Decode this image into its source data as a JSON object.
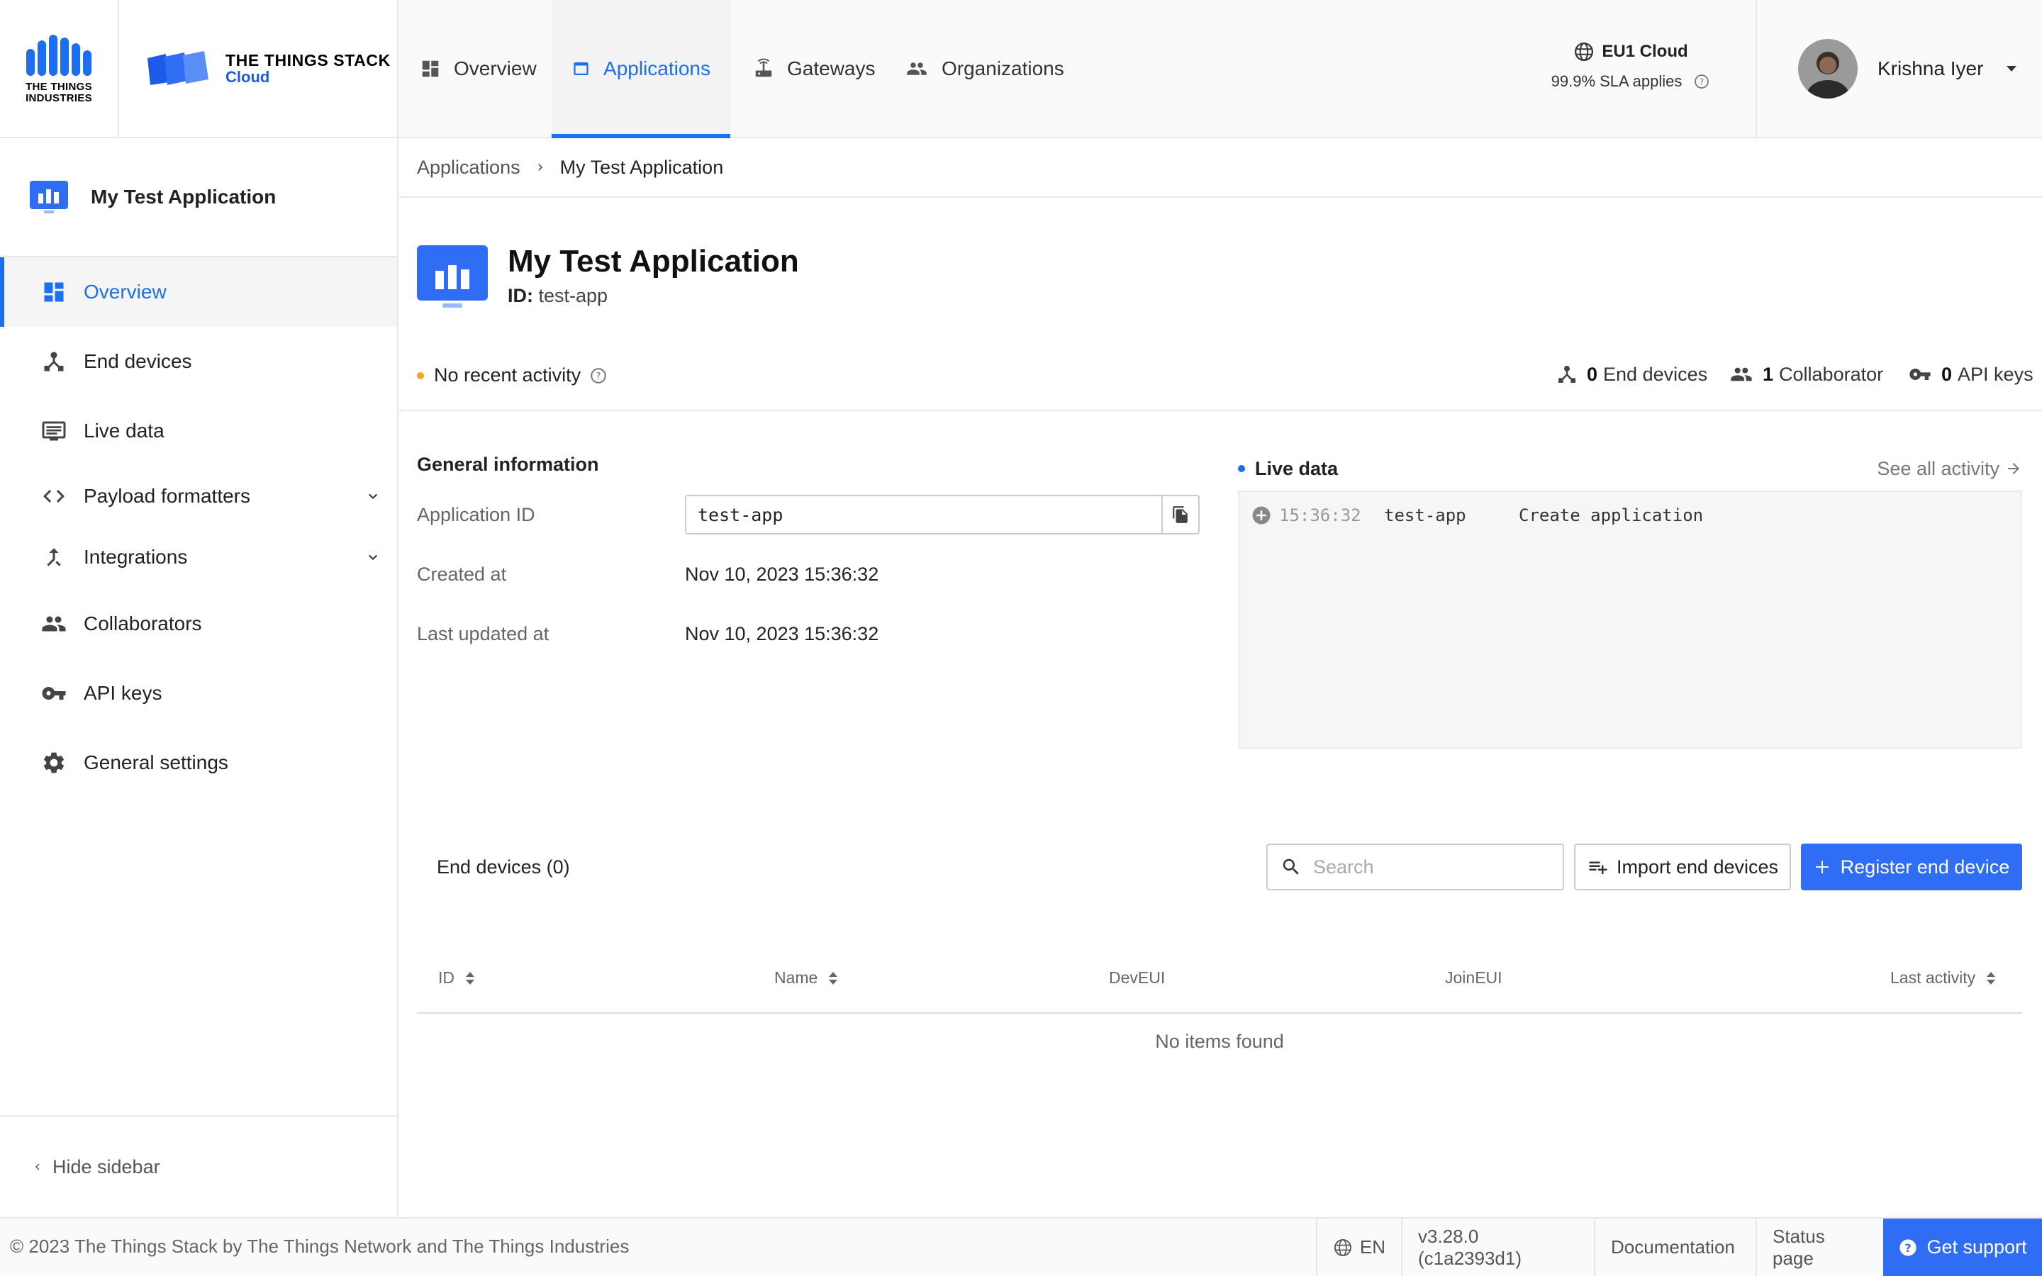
{
  "header": {
    "tti_logo_text": "THE THINGS INDUSTRIES",
    "tts_title": "THE THINGS STACK",
    "tts_subtitle": "Cloud",
    "nav": [
      {
        "label": "Overview",
        "icon": "dashboard-icon"
      },
      {
        "label": "Applications",
        "icon": "application-icon",
        "active": true
      },
      {
        "label": "Gateways",
        "icon": "gateway-icon"
      },
      {
        "label": "Organizations",
        "icon": "people-icon"
      }
    ],
    "cloud_name": "EU1 Cloud",
    "sla_text": "99.9% SLA applies",
    "user_name": "Krishna Iyer"
  },
  "sidebar": {
    "app_name": "My Test Application",
    "items": [
      {
        "label": "Overview",
        "icon": "dashboard-icon",
        "active": true
      },
      {
        "label": "End devices",
        "icon": "device-hub-icon"
      },
      {
        "label": "Live data",
        "icon": "live-data-icon"
      },
      {
        "label": "Payload formatters",
        "icon": "code-icon",
        "expandable": true
      },
      {
        "label": "Integrations",
        "icon": "integration-icon",
        "expandable": true
      },
      {
        "label": "Collaborators",
        "icon": "people-icon"
      },
      {
        "label": "API keys",
        "icon": "key-icon"
      },
      {
        "label": "General settings",
        "icon": "gear-icon"
      }
    ],
    "hide_label": "Hide sidebar"
  },
  "breadcrumb": {
    "items": [
      "Applications",
      "My Test Application"
    ]
  },
  "app": {
    "title": "My Test Application",
    "id_label": "ID:",
    "id_value": "test-app",
    "activity_status": "No recent activity",
    "stats": [
      {
        "count": "0",
        "label": "End devices",
        "icon": "device-hub-icon"
      },
      {
        "count": "1",
        "label": "Collaborator",
        "icon": "people-icon"
      },
      {
        "count": "0",
        "label": "API keys",
        "icon": "key-icon"
      }
    ]
  },
  "general_info": {
    "title": "General information",
    "rows": [
      {
        "label": "Application ID",
        "value": "test-app"
      },
      {
        "label": "Created at",
        "value": "Nov 10, 2023 15:36:32"
      },
      {
        "label": "Last updated at",
        "value": "Nov 10, 2023 15:36:32"
      }
    ]
  },
  "live_data": {
    "title": "Live data",
    "see_all": "See all activity",
    "events": [
      {
        "time": "15:36:32",
        "entity": "test-app",
        "description": "Create application"
      }
    ]
  },
  "end_devices": {
    "title": "End devices (0)",
    "search_placeholder": "Search",
    "import_label": "Import end devices",
    "register_label": "Register end device",
    "columns": [
      "ID",
      "Name",
      "DevEUI",
      "JoinEUI",
      "Last activity"
    ],
    "empty_message": "No items found"
  },
  "footer": {
    "copyright": "© 2023 The Things Stack by The Things Network and The Things Industries",
    "language": "EN",
    "version": "v3.28.0 (c1a2393d1)",
    "documentation": "Documentation",
    "status_page": "Status page",
    "support": "Get support"
  },
  "colors": {
    "accent": "#1c6ef2",
    "button": "#2f6df5",
    "activity_dot": "#f5a623"
  }
}
